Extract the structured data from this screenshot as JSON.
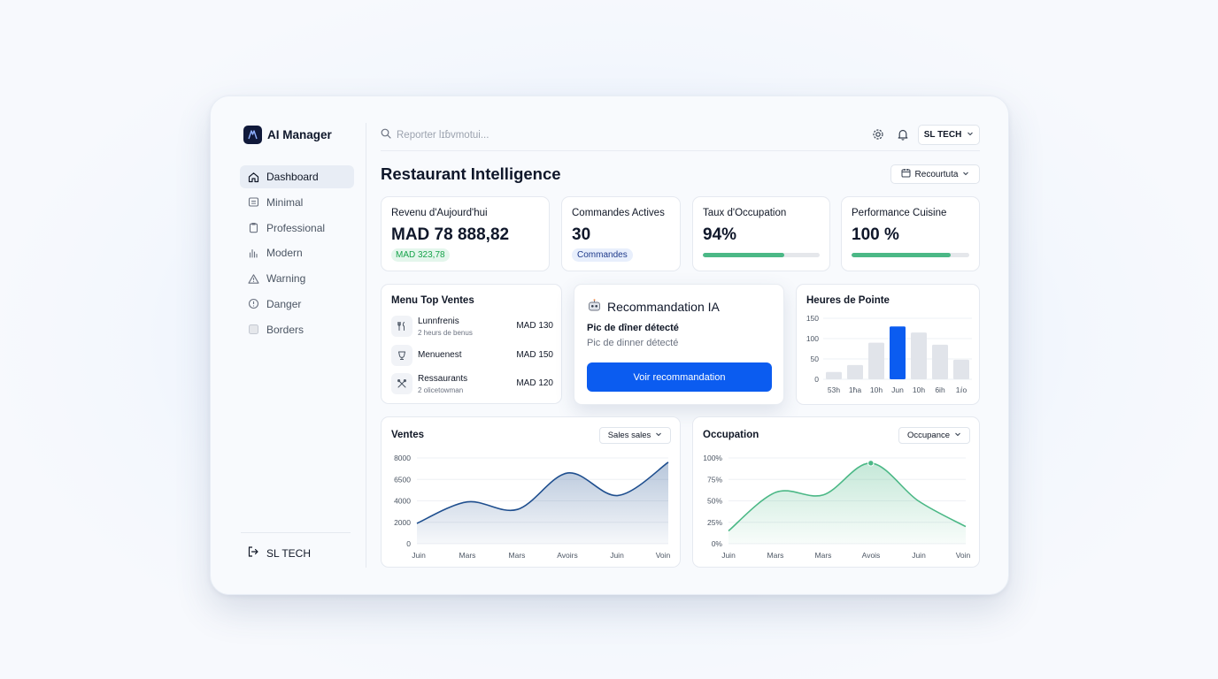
{
  "app": {
    "name": "AI Manager"
  },
  "sidebar": {
    "items": [
      {
        "label": "Dashboard",
        "icon": "home-icon",
        "active": true
      },
      {
        "label": "Minimal",
        "icon": "list-icon"
      },
      {
        "label": "Professional",
        "icon": "clipboard-icon"
      },
      {
        "label": "Modern",
        "icon": "bar-chart-icon"
      },
      {
        "label": "Warning",
        "icon": "warning-icon"
      },
      {
        "label": "Danger",
        "icon": "alert-circle-icon"
      },
      {
        "label": "Borders",
        "icon": "square-icon"
      }
    ],
    "footer_label": "SL TECH"
  },
  "header": {
    "search_placeholder": "Reporter lɪɓvmotui...",
    "org_label": "SL TECH",
    "page_title": "Restaurant Intelligence",
    "date_filter": "Recourtuta"
  },
  "kpis": {
    "revenue": {
      "label": "Revenu d'Aujourd'hui",
      "value": "MAD 78 888,82",
      "badge": "MAD 323,78"
    },
    "orders": {
      "label": "Commandes Actives",
      "value": "30",
      "badge": "Commandes"
    },
    "occupancy": {
      "label": "Taux d'Occupation",
      "value": "94%",
      "progress": 0.7
    },
    "kitchen": {
      "label": "Performance Cuisine",
      "value": "100 %",
      "progress": 0.84
    }
  },
  "top_menu": {
    "title": "Menu Top Ventes",
    "items": [
      {
        "name": "Lunnfrenis",
        "sub": "2 heurs de benus",
        "price": "MAD 130"
      },
      {
        "name": "Menuenest",
        "sub": "",
        "price": "MAD 150"
      },
      {
        "name": "Ressaurants",
        "sub": "2 olicetowman",
        "price": "MAD 120"
      }
    ]
  },
  "recommendation": {
    "title": "Recommandation IA",
    "headline": "Pic de dîner détecté",
    "subtitle": "Pic de dinner détecté",
    "button": "Voir recommandation"
  },
  "colors": {
    "primary": "#0b5cf0",
    "green": "#4bb886",
    "navy": "#10193a",
    "line_blue": "#1f4f8f"
  },
  "chart_data": [
    {
      "type": "bar",
      "title": "Heures de Pointe",
      "categories": [
        "53h",
        "1ħa",
        "10h",
        "Jun",
        "10h",
        "6ih",
        "1ⅈo"
      ],
      "values": [
        18,
        35,
        90,
        130,
        115,
        85,
        48
      ],
      "highlight_index": 3,
      "yticks": [
        "150",
        "100",
        "50",
        "0"
      ],
      "ylim": [
        0,
        150
      ],
      "grid": true
    },
    {
      "type": "area",
      "title": "Ventes",
      "dropdown": "Sales sales",
      "x": [
        "Juin",
        "Mars",
        "Mars",
        "Avoirs",
        "Juin",
        "Voin"
      ],
      "values": [
        1900,
        3900,
        3200,
        6600,
        4500,
        7600
      ],
      "yticks": [
        "8000",
        "6500",
        "4000",
        "2000",
        "0"
      ],
      "ylim": [
        0,
        8000
      ],
      "grid": true
    },
    {
      "type": "area",
      "title": "Occupation",
      "dropdown": "Occupance",
      "x": [
        "Juin",
        "Mars",
        "Mars",
        "Avois",
        "Juin",
        "Voin"
      ],
      "values": [
        15,
        60,
        57,
        94,
        50,
        20
      ],
      "marker_index": 3,
      "yticks": [
        "100%",
        "75%",
        "50%",
        "25%",
        "0%"
      ],
      "ylim": [
        0,
        100
      ],
      "grid": true
    }
  ]
}
